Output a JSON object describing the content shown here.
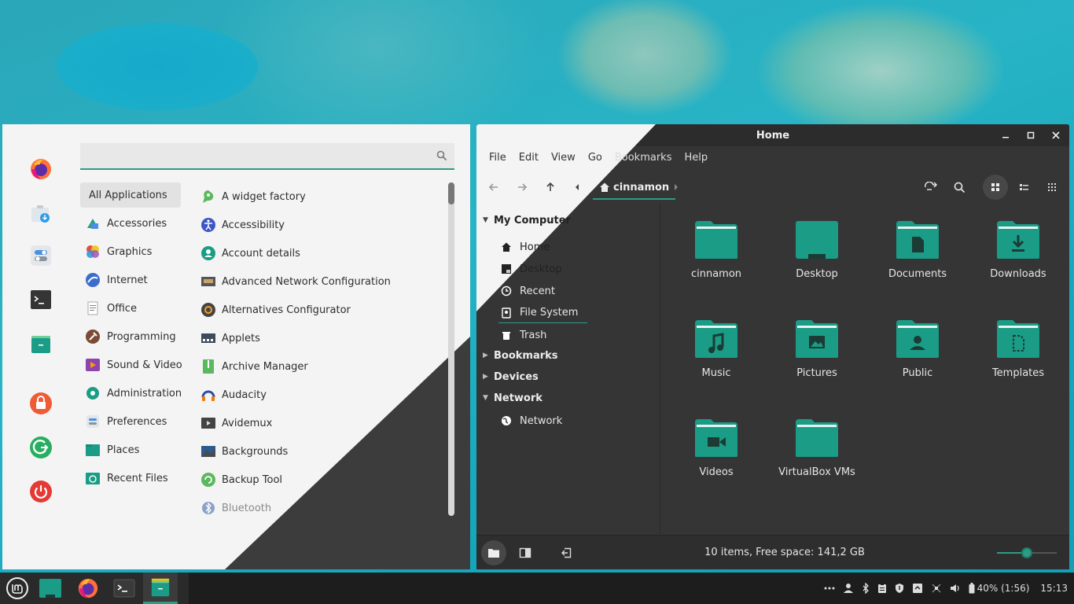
{
  "colors": {
    "accent": "#2d9b86",
    "folder": "#1b9c86",
    "folder_tab": "#138a76",
    "menu_bg": "#f4f4f4",
    "fm_bg": "#353535",
    "panel_bg": "#1d1d1d"
  },
  "start_menu": {
    "search": {
      "value": "",
      "placeholder": ""
    },
    "favorites": [
      {
        "icon": "firefox-icon"
      },
      {
        "icon": "software-manager-icon"
      },
      {
        "icon": "settings-toggle-icon"
      },
      {
        "icon": "terminal-icon"
      },
      {
        "icon": "files-icon"
      }
    ],
    "session": [
      {
        "icon": "lock-icon"
      },
      {
        "icon": "logout-icon"
      },
      {
        "icon": "power-icon"
      }
    ],
    "categories": [
      {
        "label": "All Applications",
        "icon": ""
      },
      {
        "label": "Accessories",
        "icon": "accessories-icon"
      },
      {
        "label": "Graphics",
        "icon": "graphics-icon"
      },
      {
        "label": "Internet",
        "icon": "internet-icon"
      },
      {
        "label": "Office",
        "icon": "office-icon"
      },
      {
        "label": "Programming",
        "icon": "programming-icon"
      },
      {
        "label": "Sound & Video",
        "icon": "sound-video-icon"
      },
      {
        "label": "Administration",
        "icon": "administration-icon"
      },
      {
        "label": "Preferences",
        "icon": "preferences-icon"
      },
      {
        "label": "Places",
        "icon": "places-icon"
      },
      {
        "label": "Recent Files",
        "icon": "recent-files-icon"
      }
    ],
    "apps": [
      {
        "label": "A widget factory",
        "icon": "widget-factory-icon"
      },
      {
        "label": "Accessibility",
        "icon": "accessibility-icon"
      },
      {
        "label": "Account details",
        "icon": "account-icon"
      },
      {
        "label": "Advanced Network Configuration",
        "icon": "network-config-icon"
      },
      {
        "label": "Alternatives Configurator",
        "icon": "alternatives-icon"
      },
      {
        "label": "Applets",
        "icon": "applets-icon"
      },
      {
        "label": "Archive Manager",
        "icon": "archive-icon"
      },
      {
        "label": "Audacity",
        "icon": "audacity-icon"
      },
      {
        "label": "Avidemux",
        "icon": "avidemux-icon"
      },
      {
        "label": "Backgrounds",
        "icon": "backgrounds-icon"
      },
      {
        "label": "Backup Tool",
        "icon": "backup-icon"
      },
      {
        "label": "Bluetooth",
        "icon": "bluetooth-icon"
      }
    ]
  },
  "file_manager": {
    "title": "Home",
    "menu": [
      "File",
      "Edit",
      "View",
      "Go",
      "Bookmarks",
      "Help"
    ],
    "path": "cinnamon",
    "sidebar": {
      "my_computer": "My Computer",
      "items": [
        "Home",
        "Desktop",
        "Recent",
        "File System",
        "Trash"
      ],
      "bookmarks": "Bookmarks",
      "devices": "Devices",
      "network": "Network",
      "network_items": [
        "Network"
      ]
    },
    "files": [
      {
        "name": "cinnamon",
        "glyph": ""
      },
      {
        "name": "Desktop",
        "glyph": "desktop"
      },
      {
        "name": "Documents",
        "glyph": "document"
      },
      {
        "name": "Downloads",
        "glyph": "download"
      },
      {
        "name": "Music",
        "glyph": "music"
      },
      {
        "name": "Pictures",
        "glyph": "picture"
      },
      {
        "name": "Public",
        "glyph": "public"
      },
      {
        "name": "Templates",
        "glyph": "template"
      },
      {
        "name": "Videos",
        "glyph": "video"
      },
      {
        "name": "VirtualBox VMs",
        "glyph": ""
      }
    ],
    "status": "10 items, Free space: 141,2 GB",
    "zoom_level": 0.5
  },
  "panel": {
    "battery": "40% (1:56)",
    "clock": "15:13"
  }
}
